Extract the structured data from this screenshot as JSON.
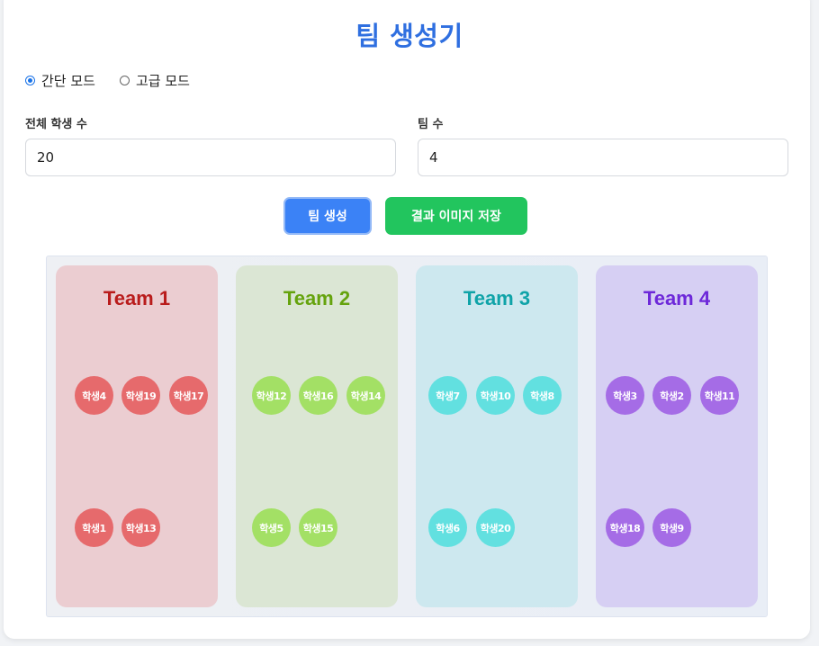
{
  "title": "팀 생성기",
  "modes": {
    "simple": "간단 모드",
    "advanced": "고급 모드",
    "selected": "simple"
  },
  "fields": {
    "students_label": "전체 학생 수",
    "students_value": "20",
    "teams_label": "팀 수",
    "teams_value": "4"
  },
  "buttons": {
    "generate": "팀 생성",
    "save_image": "결과 이미지 저장"
  },
  "teams": [
    {
      "name": "Team 1",
      "color": "#b91c1c",
      "bg": "#ebcdd1",
      "member_color": "#e66a6c",
      "members": [
        "학생4",
        "학생19",
        "학생17",
        "학생1",
        "학생13"
      ]
    },
    {
      "name": "Team 2",
      "color": "#65a30d",
      "bg": "#dbe6d4",
      "member_color": "#a3e065",
      "members": [
        "학생12",
        "학생16",
        "학생14",
        "학생5",
        "학생15"
      ]
    },
    {
      "name": "Team 3",
      "color": "#0fa3a8",
      "bg": "#cde8ef",
      "member_color": "#62e0e0",
      "members": [
        "학생7",
        "학생10",
        "학생8",
        "학생6",
        "학생20"
      ]
    },
    {
      "name": "Team 4",
      "color": "#6d28d9",
      "bg": "#d6cff3",
      "member_color": "#a56ce6",
      "members": [
        "학생3",
        "학생2",
        "학생11",
        "학생18",
        "학생9"
      ]
    }
  ]
}
